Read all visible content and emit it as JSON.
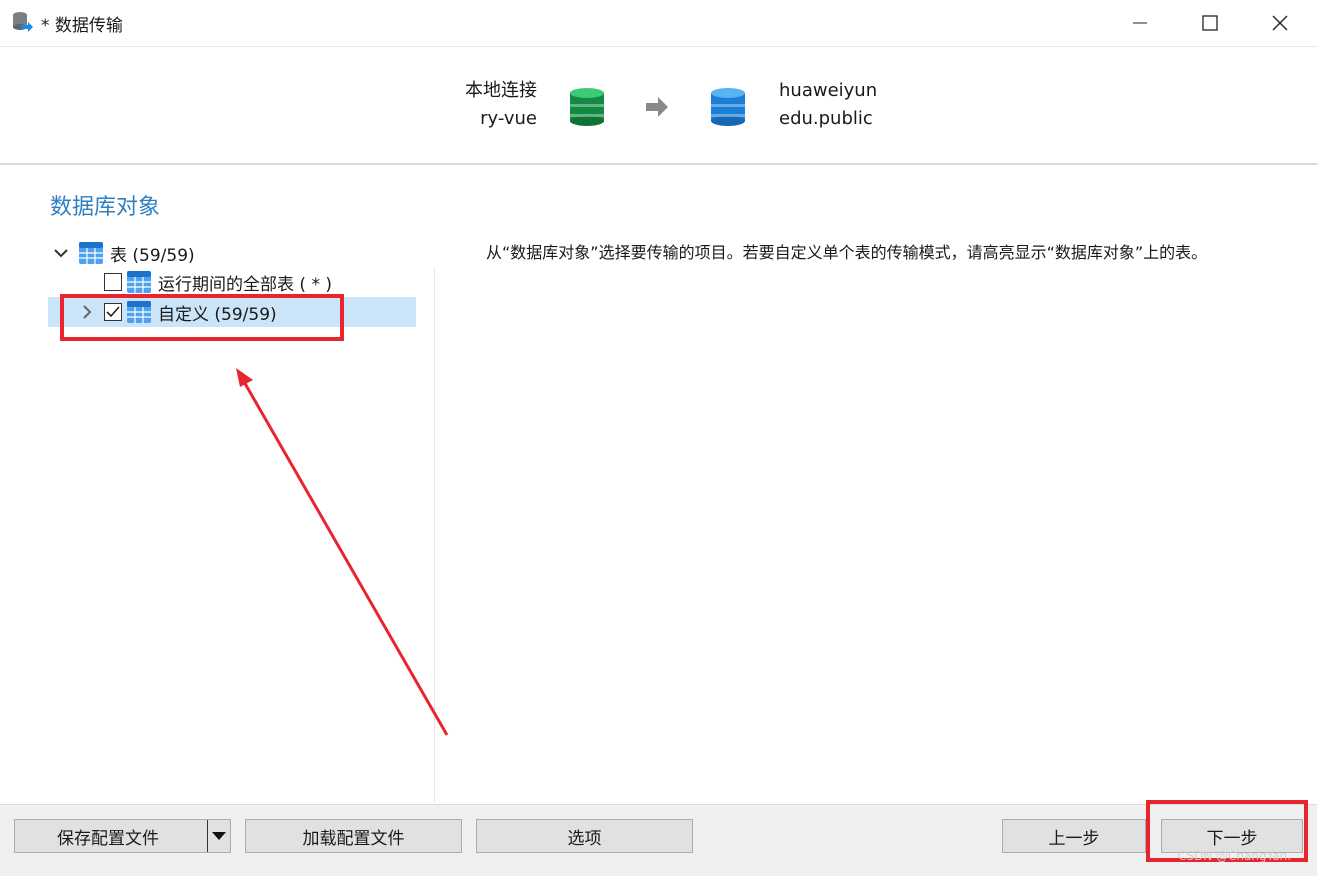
{
  "window": {
    "title": "* 数据传输",
    "app_icon": "database-transfer-icon",
    "minimize_icon": "minimize-icon",
    "maximize_icon": "maximize-icon",
    "close_icon": "close-icon"
  },
  "header": {
    "source": {
      "connection": "本地连接",
      "database": "ry-vue",
      "icon": "database-green-icon",
      "color": "#1faa59"
    },
    "target": {
      "connection": "huaweiyun",
      "database": "edu.public",
      "icon": "database-blue-icon",
      "color": "#1e88e5"
    },
    "arrow_icon": "arrow-right-icon"
  },
  "section_title": "数据库对象",
  "tree": {
    "root": {
      "label": "表 (59/59)",
      "expanded": true,
      "icon": "table-icon"
    },
    "children": [
      {
        "label": "运行期间的全部表 ( * )",
        "checked": false,
        "icon": "table-icon"
      },
      {
        "label": "自定义 (59/59)",
        "checked": true,
        "selected": true,
        "icon": "table-icon"
      }
    ]
  },
  "description": "从“数据库对象”选择要传输的项目。若要自定义单个表的传输模式，请高亮显示“数据库对象”上的表。",
  "footer": {
    "save_profile": "保存配置文件",
    "load_profile": "加载配置文件",
    "options": "选项",
    "back": "上一步",
    "next": "下一步"
  },
  "annotation_color": "#e8252f",
  "watermark": "CSDN @ChangYan."
}
